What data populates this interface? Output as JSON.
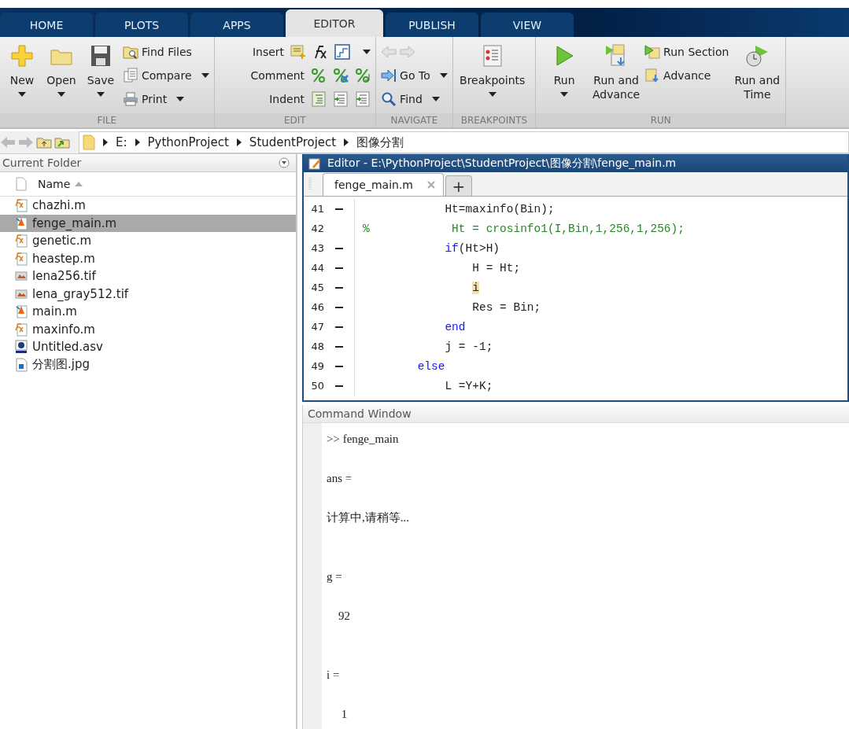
{
  "tabs": [
    {
      "label": "HOME",
      "selected": false
    },
    {
      "label": "PLOTS",
      "selected": false
    },
    {
      "label": "APPS",
      "selected": false
    },
    {
      "label": "EDITOR",
      "selected": true
    },
    {
      "label": "PUBLISH",
      "selected": false
    },
    {
      "label": "VIEW",
      "selected": false
    }
  ],
  "ribbon": [
    {
      "title": "FILE",
      "items": [
        {
          "kind": "large",
          "label": "New",
          "dropdown": true
        },
        {
          "kind": "large",
          "label": "Open",
          "dropdown": true
        },
        {
          "kind": "large",
          "label": "Save",
          "dropdown": true
        },
        {
          "kind": "stack",
          "rows": [
            {
              "label": "Find Files",
              "dropdown": false
            },
            {
              "label": "Compare",
              "dropdown": true
            },
            {
              "label": "Print",
              "dropdown": true
            }
          ]
        }
      ]
    },
    {
      "title": "EDIT",
      "items": [
        {
          "kind": "icon_rows",
          "rows": [
            {
              "label": "Insert",
              "dropdown": true
            },
            {
              "label": "Comment",
              "dropdown": false
            },
            {
              "label": "Indent",
              "dropdown": false
            }
          ]
        }
      ]
    },
    {
      "title": "NAVIGATE",
      "items": [
        {
          "kind": "stack",
          "rows": [
            {
              "kind": "arrows",
              "disabled": true
            },
            {
              "label": "Go To",
              "dropdown": true
            },
            {
              "label": "Find",
              "dropdown": true
            }
          ]
        }
      ]
    },
    {
      "title": "BREAKPOINTS",
      "items": [
        {
          "kind": "large",
          "label": "Breakpoints",
          "dropdown": true
        }
      ]
    },
    {
      "title": "RUN",
      "items": [
        {
          "kind": "large",
          "label": "Run",
          "dropdown": true
        },
        {
          "kind": "large",
          "label": "Run and Advance",
          "dropdown": false
        },
        {
          "kind": "stack",
          "rows": [
            {
              "label": "Run Section",
              "dropdown": false
            },
            {
              "label": "Advance",
              "dropdown": false
            }
          ]
        },
        {
          "kind": "large",
          "label": "Run and Time",
          "dropdown": false
        }
      ]
    }
  ],
  "path": [
    "E:",
    "PythonProject",
    "StudentProject",
    "图像分割"
  ],
  "current_folder": {
    "title": "Current Folder",
    "column": "Name",
    "files": [
      {
        "name": "chazhi.m",
        "kind": "function",
        "selected": false
      },
      {
        "name": "fenge_main.m",
        "kind": "script",
        "selected": true
      },
      {
        "name": "genetic.m",
        "kind": "function",
        "selected": false
      },
      {
        "name": "heastep.m",
        "kind": "function",
        "selected": false
      },
      {
        "name": "lena256.tif",
        "kind": "image",
        "selected": false
      },
      {
        "name": "lena_gray512.tif",
        "kind": "image",
        "selected": false
      },
      {
        "name": "main.m",
        "kind": "script",
        "selected": false
      },
      {
        "name": "maxinfo.m",
        "kind": "function",
        "selected": false
      },
      {
        "name": "Untitled.asv",
        "kind": "asv",
        "selected": false
      },
      {
        "name": "分割图.jpg",
        "kind": "picture_file",
        "selected": false
      }
    ]
  },
  "editor": {
    "title": "Editor - E:\\PythonProject\\StudentProject\\图像分割\\fenge_main.m",
    "tabs": [
      {
        "label": "fenge_main.m",
        "selected": true
      }
    ],
    "add_tab": "+",
    "lines": [
      {
        "number": "41",
        "executable": true,
        "parts": [
          {
            "text": "            Ht=maxinfo(Bin);",
            "kind": "code"
          }
        ]
      },
      {
        "number": "42",
        "executable": false,
        "parts": [
          {
            "text": "%            Ht = crosinfo1(I,Bin,1,256,1,256);",
            "kind": "comment"
          }
        ]
      },
      {
        "number": "43",
        "executable": true,
        "parts": [
          {
            "text": "            if",
            "kind": "keyword"
          },
          {
            "text": "(Ht>H)",
            "kind": "code"
          }
        ]
      },
      {
        "number": "44",
        "executable": true,
        "parts": [
          {
            "text": "                H = Ht;",
            "kind": "code"
          }
        ]
      },
      {
        "number": "45",
        "executable": true,
        "parts": [
          {
            "text": "                i",
            "kind": "highlight"
          }
        ]
      },
      {
        "number": "46",
        "executable": true,
        "parts": [
          {
            "text": "                Res = Bin;",
            "kind": "code"
          }
        ]
      },
      {
        "number": "47",
        "executable": true,
        "parts": [
          {
            "text": "            end",
            "kind": "keyword"
          }
        ]
      },
      {
        "number": "48",
        "executable": true,
        "parts": [
          {
            "text": "            j = -1;",
            "kind": "code"
          }
        ]
      },
      {
        "number": "49",
        "executable": true,
        "parts": [
          {
            "text": "        else",
            "kind": "keyword"
          }
        ]
      },
      {
        "number": "50",
        "executable": true,
        "parts": [
          {
            "text": "            L =Y+K;",
            "kind": "code"
          }
        ]
      }
    ]
  },
  "command_window": {
    "title": "Command Window",
    "lines": [
      {
        "kind": "command",
        "prompt": ">>",
        "text": "fenge_main"
      },
      {
        "kind": "variable",
        "text": "ans ="
      },
      {
        "kind": "value",
        "text": "计算中,请稍等..."
      },
      {
        "kind": "variable",
        "text": "g ="
      },
      {
        "kind": "value",
        "text": "    92"
      },
      {
        "kind": "variable",
        "text": "i ="
      },
      {
        "kind": "value",
        "text": "     1"
      }
    ]
  }
}
